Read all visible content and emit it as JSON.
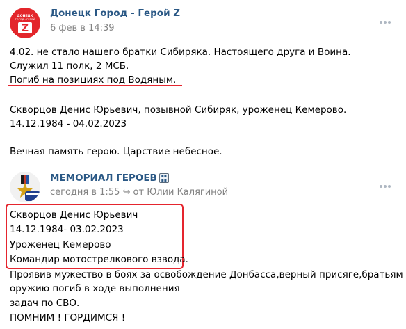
{
  "posts": [
    {
      "author": "Донецк Город - Герой Z",
      "meta": "6 фев в 14:39",
      "lines": [
        "4.02. не стало нашего братки Сибиряка. Настоящего друга и Воина.",
        "Служил 11 полк, 2 МСБ.",
        "Погиб на позициях под Водяным.",
        "",
        "Скворцов Денис Юрьевич, позывной Сибиряк, уроженец Кемерово.",
        "14.12.1984 - 04.02.2023",
        "",
        "Вечная память герою. Царствие небесное."
      ]
    },
    {
      "author": "МЕМОРИАЛ ГЕРОЕВ",
      "meta_time": "сегодня в 1:55",
      "meta_from": "от Юлии Калягиной",
      "lines": [
        "Скворцов Денис Юрьевич",
        "14.12.1984- 03.02.2023",
        "Уроженец Кемерово",
        "Командир мотострелкового взвода.",
        "Проявив мужество в боях за освобождение Донбасса,верный присяге,братьям по",
        "оружию погиб в ходе выполнения",
        "задач по СВО.",
        "ПОМНИМ ! ГОРДИМСЯ !"
      ]
    }
  ],
  "avatar1": {
    "text_top": "ДОНЕЦК",
    "text_mid": "ГОРОД - ГЕРОЙ",
    "letter": "Z"
  },
  "colors": {
    "accent_red": "#e5252e",
    "link": "#2a5885",
    "meta": "#828282"
  }
}
